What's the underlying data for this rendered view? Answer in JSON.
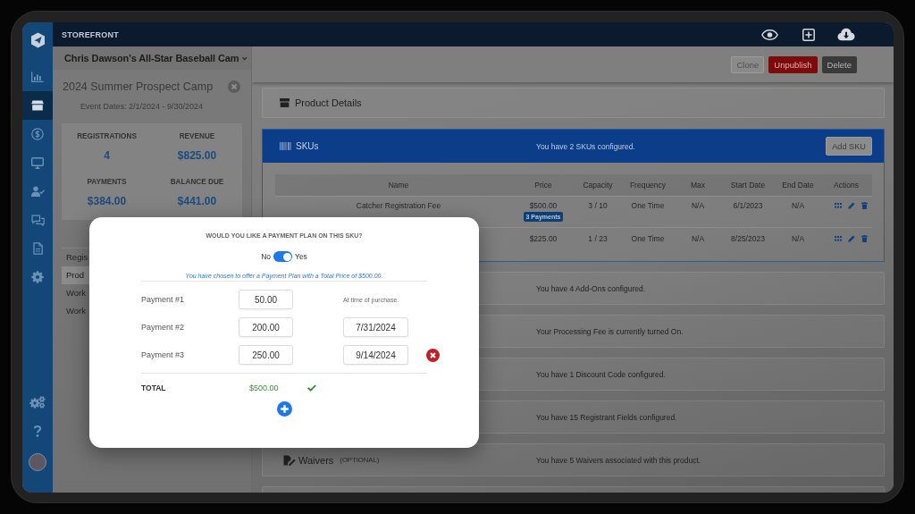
{
  "sidebar": {
    "items": [
      {
        "selected": false
      },
      {
        "selected": true
      },
      {
        "selected": false
      },
      {
        "selected": false
      },
      {
        "selected": false
      },
      {
        "selected": false
      },
      {
        "selected": false
      },
      {
        "selected": false
      }
    ]
  },
  "top_bar": {
    "title": "STOREFRONT"
  },
  "left_panel": {
    "organization": "Chris Dawson's All-Star Baseball Cam",
    "event_title": "2024 Summer Prospect Camp",
    "event_dates": "Event Dates: 2/1/2024 - 9/30/2024",
    "stats": [
      {
        "label": "REGISTRATIONS",
        "value": "4"
      },
      {
        "label": "REVENUE",
        "value": "$825.00"
      },
      {
        "label": "PAYMENTS",
        "value": "$384.00"
      },
      {
        "label": "BALANCE DUE",
        "value": "$441.00"
      }
    ],
    "nav": [
      {
        "label": "Regis",
        "selected": false
      },
      {
        "label": "Prod",
        "selected": true
      },
      {
        "label": "Work",
        "selected": false
      },
      {
        "label": "Work",
        "selected": false
      }
    ]
  },
  "actions": [
    {
      "label": "Clone",
      "kind": "secondary"
    },
    {
      "label": "Unpublish",
      "kind": "danger"
    },
    {
      "label": "Delete",
      "kind": "dark"
    }
  ],
  "product_details": {
    "title": "Product Details"
  },
  "skus": {
    "title": "SKUs",
    "summary": "You have 2 SKUs configured.",
    "add_button": "Add SKU",
    "columns": [
      "Name",
      "Price",
      "Capacity",
      "Frequency",
      "Max",
      "Start Date",
      "End Date",
      "Actions"
    ],
    "rows": [
      {
        "name": "Catcher Registration Fee",
        "price": "$500.00",
        "badge": "3 Payments",
        "capacity": "3 / 10",
        "frequency": "One Time",
        "max": "N/A",
        "start_date": "6/1/2023",
        "end_date": "N/A"
      },
      {
        "price": "$225.00",
        "capacity": "1 / 23",
        "frequency": "One Time",
        "max": "N/A",
        "start_date": "8/25/2023",
        "end_date": "N/A"
      }
    ]
  },
  "sections": [
    {
      "summary": "You have 4 Add-Ons configured."
    },
    {
      "summary": "Your Processing Fee is currently turned On."
    },
    {
      "summary": "You have 1 Discount Code configured."
    },
    {
      "summary": "You have 15 Registrant Fields configured."
    },
    {
      "title": "Waivers",
      "note": "(OPTIONAL)",
      "summary": "You have 5 Waivers associated with this product."
    }
  ],
  "modal": {
    "question": "WOULD YOU LIKE A PAYMENT PLAN ON THIS SKU?",
    "toggle": {
      "off_label": "No",
      "on_label": "Yes",
      "on": true
    },
    "message": "You have chosen to offer a Payment Plan with a Total Price of $500.00.",
    "payments": [
      {
        "label": "Payment #1",
        "amount": "50.00",
        "kind": "immediate",
        "due": "At time of purchase.",
        "removable": false
      },
      {
        "label": "Payment #2",
        "amount": "200.00",
        "kind": "scheduled",
        "date": "7/31/2024",
        "removable": false
      },
      {
        "label": "Payment #3",
        "amount": "250.00",
        "kind": "scheduled",
        "date": "9/14/2024",
        "removable": true
      }
    ],
    "total": {
      "label": "TOTAL",
      "value": "$500.00",
      "valid": true
    }
  }
}
